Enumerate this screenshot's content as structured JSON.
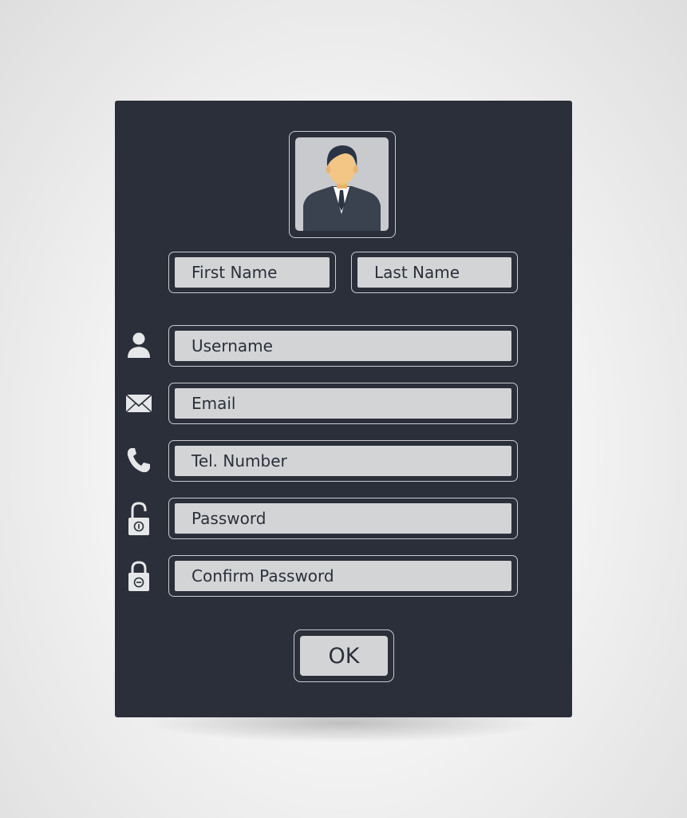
{
  "form": {
    "first_name": "First Name",
    "last_name": "Last Name",
    "username": "Username",
    "email": "Email",
    "tel_number": "Tel. Number",
    "password": "Password",
    "confirm_password": "Confirm Password",
    "ok_label": "OK"
  },
  "icons": {
    "avatar": "person-avatar-icon",
    "username": "user-icon",
    "email": "envelope-icon",
    "phone": "phone-icon",
    "password": "open-lock-icon",
    "confirm_password": "closed-lock-icon"
  },
  "colors": {
    "panel": "#2a2f3a",
    "field": "#d3d4d6",
    "border": "#c9cbce",
    "icon": "#e6e7e8",
    "avatar_bg": "#c8cacd",
    "suit": "#3a4250",
    "skin": "#f4c685",
    "hair": "#2a3444"
  }
}
